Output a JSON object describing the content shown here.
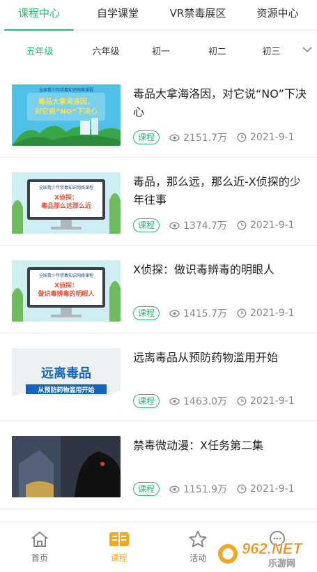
{
  "top_tabs": [
    {
      "label": "课程中心",
      "active": true
    },
    {
      "label": "自学课堂"
    },
    {
      "label": "VR禁毒展区"
    },
    {
      "label": "资源中心"
    }
  ],
  "grades": [
    "五年级",
    "六年级",
    "初一",
    "初二",
    "初三"
  ],
  "grade_more": "﹀",
  "items": [
    {
      "title": "毒品大拿海洛因，对它说“NO”下决心",
      "tag": "课程",
      "views": "2151.7万",
      "date": "2021-9-1",
      "thumb_header": "全国青少年禁毒知识网络课程",
      "thumb_text_1": "毒品大拿海洛因，",
      "thumb_text_2": "对它说“NO”下决心"
    },
    {
      "title": "毒品，那么远，那么近-X侦探的少年往事",
      "tag": "课程",
      "views": "1374.7万",
      "date": "2021-9-1",
      "thumb_header": "全国青少年禁毒知识网络课程",
      "thumb_text_1": "X侦探：",
      "thumb_text_2": "毒品那么远那么近"
    },
    {
      "title": "X侦探：做识毒辨毒的明眼人",
      "tag": "课程",
      "views": "1415.7万",
      "date": "2021-9-1",
      "thumb_header": "全国青少年禁毒知识网络课程",
      "thumb_text_1": "X侦探：",
      "thumb_text_2": "做识毒辨毒的明眼人"
    },
    {
      "title": "远离毒品从预防药物滥用开始",
      "tag": "课程",
      "views": "1463.0万",
      "date": "2021-9-1",
      "thumb_text_1": "远离毒品",
      "thumb_text_2": "从预防药物滥用开始"
    },
    {
      "title": "禁毒微动漫：X任务第二集",
      "tag": "课程",
      "views": "1151.9万",
      "date": "2021-9-1"
    }
  ],
  "bottom_nav": [
    {
      "label": "首页",
      "icon": "home-icon"
    },
    {
      "label": "课程",
      "icon": "book-icon",
      "active": true
    },
    {
      "label": "活动",
      "icon": "star-icon"
    },
    {
      "label": "",
      "icon": "chat-icon"
    }
  ],
  "watermark": {
    "brand": "962.NET",
    "sub": "乐游网"
  },
  "colors": {
    "accent": "#2bb673",
    "nav_active": "#f5a623"
  }
}
